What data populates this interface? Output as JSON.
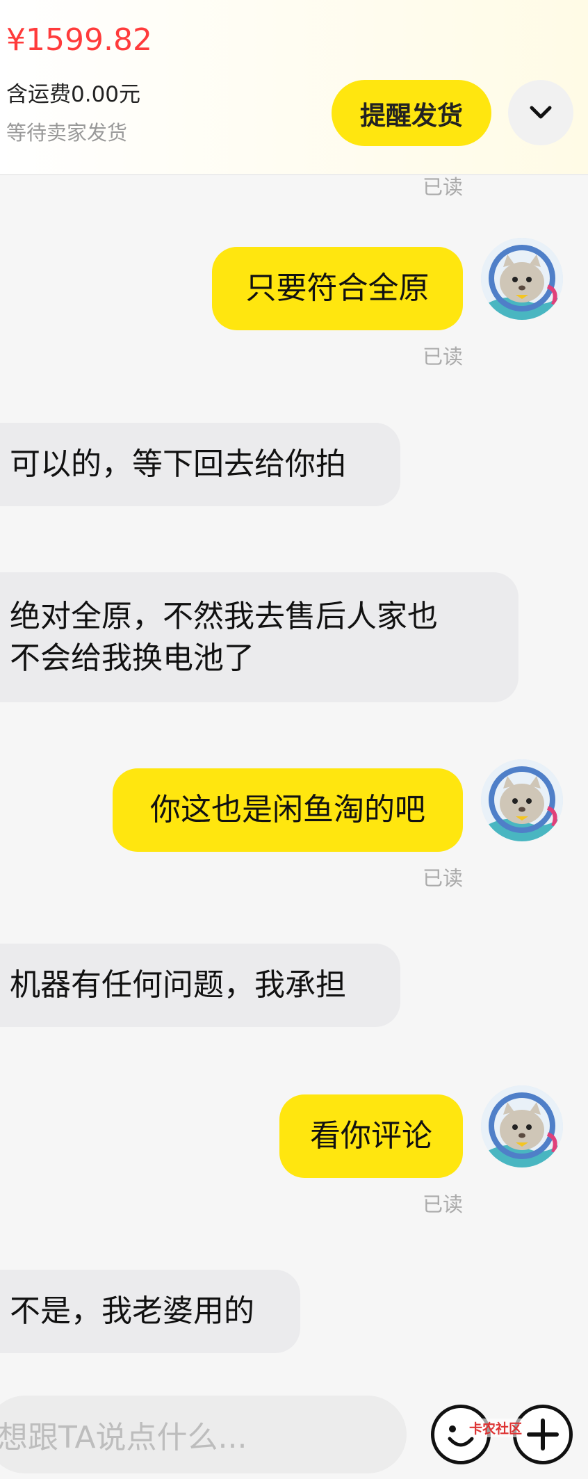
{
  "header": {
    "price": "¥1599.82",
    "shipping": "含运费0.00元",
    "status": "等待卖家发货",
    "remind_button": "提醒发货",
    "expand_icon": "chevron-down-icon"
  },
  "read_label": "已读",
  "messages": [
    {
      "from": "me",
      "text": "只要符合全原",
      "read": "已读"
    },
    {
      "from": "other",
      "text": "可以的，等下回去给你拍"
    },
    {
      "from": "other",
      "lines": [
        "绝对全原，不然我去售后人家也",
        "不会给我换电池了"
      ]
    },
    {
      "from": "me",
      "text": "你这也是闲鱼淘的吧",
      "read": "已读"
    },
    {
      "from": "other",
      "text": "机器有任何问题，我承担"
    },
    {
      "from": "me",
      "text": "看你评论",
      "read": "已读"
    },
    {
      "from": "other",
      "text": "不是，我老婆用的"
    }
  ],
  "input": {
    "placeholder": "想跟TA说点什么..."
  },
  "watermark": "卡农社区",
  "colors": {
    "accent_yellow": "#ffe60f",
    "price_red": "#ff3b3b",
    "other_bubble": "#ebebed"
  }
}
